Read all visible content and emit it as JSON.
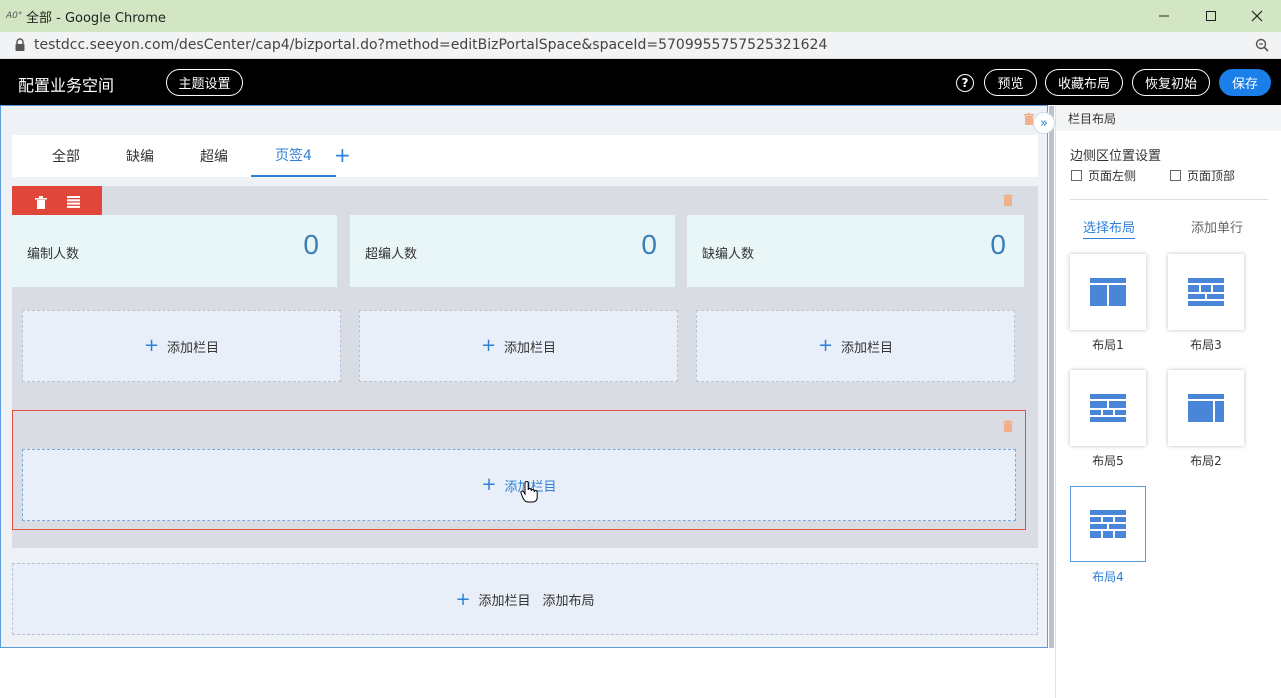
{
  "window": {
    "title": "全部 - Google Chrome",
    "app_icon": "A0°",
    "url": "testdcc.seeyon.com/desCenter/cap4/bizportal.do?method=editBizPortalSpace&spaceId=5709955757525321624"
  },
  "header": {
    "title": "配置业务空间",
    "theme_button": "主题设置",
    "help_label": "?",
    "preview_button": "预览",
    "favorite_button": "收藏布局",
    "reset_button": "恢复初始",
    "save_button": "保存"
  },
  "tabs": [
    {
      "label": "全部",
      "active": false
    },
    {
      "label": "缺编",
      "active": false
    },
    {
      "label": "超编",
      "active": false
    },
    {
      "label": "页签4",
      "active": true
    }
  ],
  "stats": [
    {
      "label": "编制人数",
      "value": "0"
    },
    {
      "label": "超编人数",
      "value": "0"
    },
    {
      "label": "缺编人数",
      "value": "0"
    }
  ],
  "slots": {
    "add_column": "添加栏目",
    "add_layout": "添加布局"
  },
  "right_panel": {
    "header": "栏目布局",
    "sidebar_title": "边侧区位置设置",
    "checkbox_left": "页面左侧",
    "checkbox_top": "页面顶部",
    "tab_select_layout": "选择布局",
    "tab_add_row": "添加单行",
    "layouts": [
      {
        "label": "布局1",
        "selected": false
      },
      {
        "label": "布局3",
        "selected": false
      },
      {
        "label": "布局5",
        "selected": false
      },
      {
        "label": "布局2",
        "selected": false
      },
      {
        "label": "布局4",
        "selected": true
      }
    ]
  },
  "colors": {
    "accent": "#2d7fd8",
    "danger": "#e0473a",
    "header_bg": "#000000",
    "chrome_title_bg": "#d3e6c3"
  }
}
